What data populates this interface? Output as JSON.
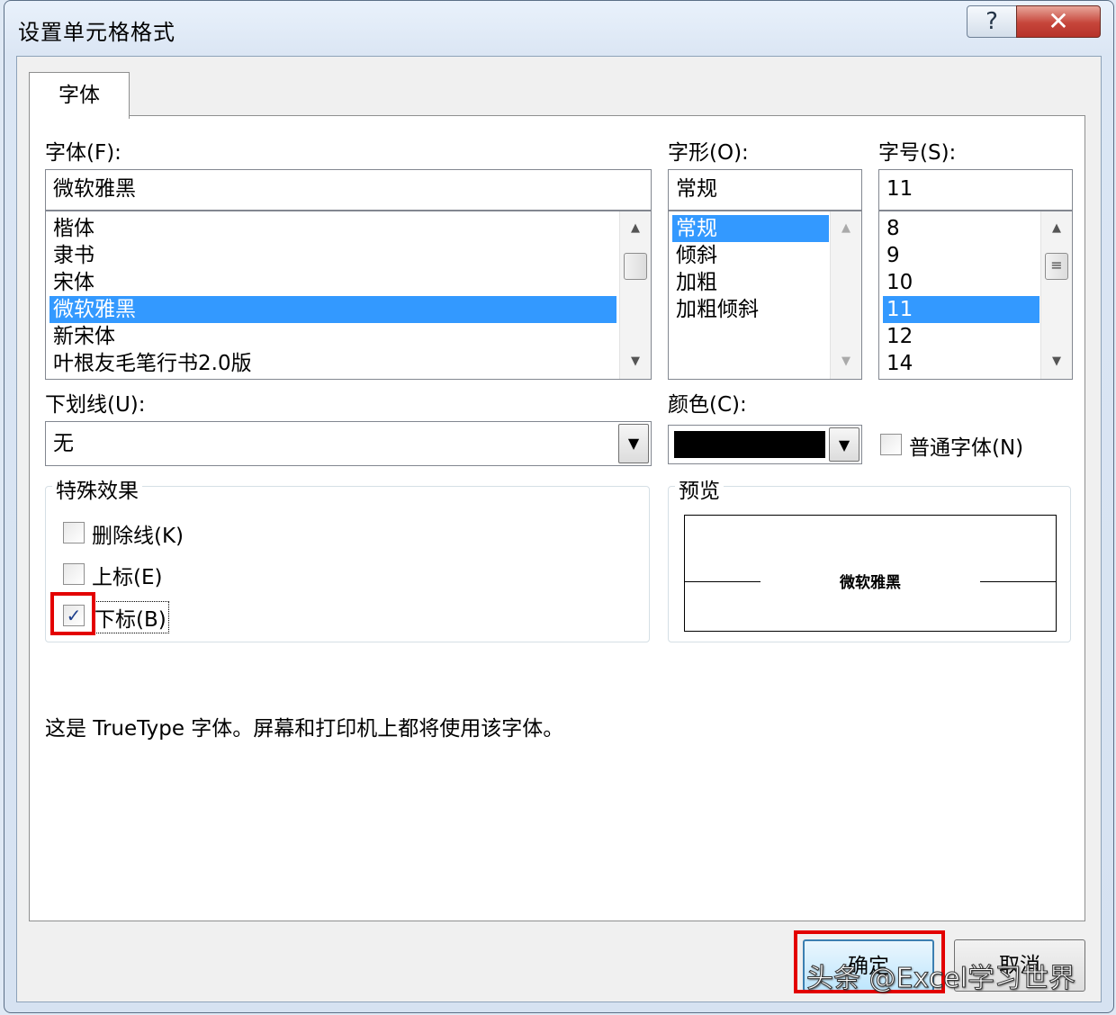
{
  "dialog": {
    "title": "设置单元格格式",
    "help_glyph": "?",
    "close_glyph": "✕"
  },
  "tabs": [
    {
      "label": "字体"
    }
  ],
  "font": {
    "label": "字体(F):",
    "value": "微软雅黑",
    "items": [
      "楷体",
      "隶书",
      "宋体",
      "微软雅黑",
      "新宋体",
      "叶根友毛笔行书2.0版"
    ],
    "selected": "微软雅黑"
  },
  "style": {
    "label": "字形(O):",
    "value": "常规",
    "items": [
      "常规",
      "倾斜",
      "加粗",
      "加粗倾斜"
    ],
    "selected": "常规"
  },
  "size": {
    "label": "字号(S):",
    "value": "11",
    "items": [
      "8",
      "9",
      "10",
      "11",
      "12",
      "14"
    ],
    "selected": "11"
  },
  "underline": {
    "label": "下划线(U):",
    "value": "无"
  },
  "color": {
    "label": "颜色(C):",
    "value": "#000000"
  },
  "normal_font": {
    "label": "普通字体(N)",
    "checked": false
  },
  "effects": {
    "title": "特殊效果",
    "strikethrough": {
      "label": "删除线(K)",
      "checked": false
    },
    "superscript": {
      "label": "上标(E)",
      "checked": false
    },
    "subscript": {
      "label": "下标(B)",
      "checked": true
    }
  },
  "preview": {
    "title": "预览",
    "sample": "微软雅黑"
  },
  "info_text": "这是 TrueType 字体。屏幕和打印机上都将使用该字体。",
  "buttons": {
    "ok": "确定",
    "cancel": "取消"
  },
  "watermark": "头条 @Excel学习世界",
  "icons": {
    "scroll_up": "up-arrow-icon",
    "scroll_down": "down-arrow-icon",
    "dropdown": "chevron-down-icon",
    "check": "check-icon"
  },
  "colors": {
    "selection": "#3399ff",
    "highlight": "#e30000"
  }
}
